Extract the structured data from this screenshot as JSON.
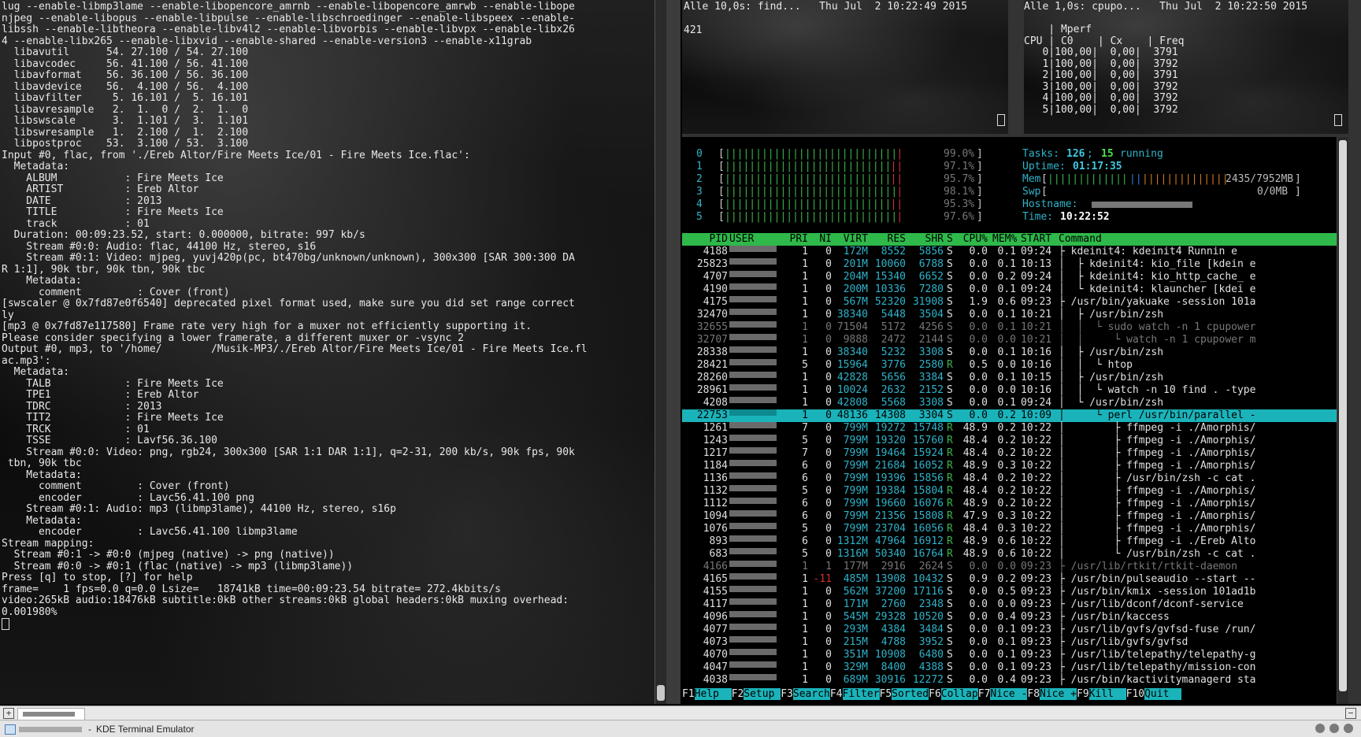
{
  "left_terminal": {
    "lines": [
      "lug --enable-libmp3lame --enable-libopencore_amrnb --enable-libopencore_amrwb --enable-libope",
      "njpeg --enable-libopus --enable-libpulse --enable-libschroedinger --enable-libspeex --enable-",
      "libssh --enable-libtheora --enable-libv4l2 --enable-libvorbis --enable-libvpx --enable-libx26",
      "4 --enable-libx265 --enable-libxvid --enable-shared --enable-version3 --enable-x11grab",
      "  libavutil      54. 27.100 / 54. 27.100",
      "  libavcodec     56. 41.100 / 56. 41.100",
      "  libavformat    56. 36.100 / 56. 36.100",
      "  libavdevice    56.  4.100 / 56.  4.100",
      "  libavfilter     5. 16.101 /  5. 16.101",
      "  libavresample   2.  1.  0 /  2.  1.  0",
      "  libswscale      3.  1.101 /  3.  1.101",
      "  libswresample   1.  2.100 /  1.  2.100",
      "  libpostproc    53.  3.100 / 53.  3.100",
      "Input #0, flac, from './Ereb Altor/Fire Meets Ice/01 - Fire Meets Ice.flac':",
      "  Metadata:",
      "    ALBUM           : Fire Meets Ice",
      "    ARTIST          : Ereb Altor",
      "    DATE            : 2013",
      "    TITLE           : Fire Meets Ice",
      "    track           : 01",
      "  Duration: 00:09:23.52, start: 0.000000, bitrate: 997 kb/s",
      "    Stream #0:0: Audio: flac, 44100 Hz, stereo, s16",
      "    Stream #0:1: Video: mjpeg, yuvj420p(pc, bt470bg/unknown/unknown), 300x300 [SAR 300:300 DA",
      "R 1:1], 90k tbr, 90k tbn, 90k tbc",
      "    Metadata:",
      "      comment         : Cover (front)",
      "[swscaler @ 0x7fd87e0f6540] deprecated pixel format used, make sure you did set range correct",
      "ly",
      "[mp3 @ 0x7fd87e117580] Frame rate very high for a muxer not efficiently supporting it.",
      "Please consider specifying a lower framerate, a different muxer or -vsync 2",
      "Output #0, mp3, to '/home/        /Musik-MP3/./Ereb Altor/Fire Meets Ice/01 - Fire Meets Ice.fl",
      "ac.mp3':",
      "  Metadata:",
      "    TALB            : Fire Meets Ice",
      "    TPE1            : Ereb Altor",
      "    TDRC            : 2013",
      "    TIT2            : Fire Meets Ice",
      "    TRCK            : 01",
      "    TSSE            : Lavf56.36.100",
      "    Stream #0:0: Video: png, rgb24, 300x300 [SAR 1:1 DAR 1:1], q=2-31, 200 kb/s, 90k fps, 90k",
      " tbn, 90k tbc",
      "    Metadata:",
      "      comment         : Cover (front)",
      "      encoder         : Lavc56.41.100 png",
      "    Stream #0:1: Audio: mp3 (libmp3lame), 44100 Hz, stereo, s16p",
      "    Metadata:",
      "      encoder         : Lavc56.41.100 libmp3lame",
      "Stream mapping:",
      "  Stream #0:1 -> #0:0 (mjpeg (native) -> png (native))",
      "  Stream #0:0 -> #0:1 (flac (native) -> mp3 (libmp3lame))",
      "Press [q] to stop, [?] for help",
      "frame=    1 fps=0.0 q=0.0 Lsize=   18741kB time=00:09:23.54 bitrate= 272.4kbits/s",
      "video:265kB audio:18476kB subtitle:0kB other streams:0kB global headers:0kB muxing overhead:",
      "0.001980%"
    ]
  },
  "watch_find": {
    "header": "Alle 10,0s: find...   Thu Jul  2 10:22:49 2015",
    "output": "421"
  },
  "watch_cpupower": {
    "header": "Alle 1,0s: cpupo...   Thu Jul  2 10:22:50 2015",
    "lines": [
      "    | Mperf",
      "CPU | C0    | Cx    | Freq",
      "   0|100,00|  0,00|  3791",
      "   1|100,00|  0,00|  3792",
      "   2|100,00|  0,00|  3791",
      "   3|100,00|  0,00|  3792",
      "   4|100,00|  0,00|  3792",
      "   5|100,00|  0,00|  3792"
    ]
  },
  "htop": {
    "cpus": [
      {
        "n": "0",
        "pct": "99.0%",
        "red": 1
      },
      {
        "n": "1",
        "pct": "97.1%",
        "red": 2
      },
      {
        "n": "2",
        "pct": "95.7%",
        "red": 2
      },
      {
        "n": "3",
        "pct": "98.1%",
        "red": 1
      },
      {
        "n": "4",
        "pct": "95.3%",
        "red": 2
      },
      {
        "n": "5",
        "pct": "97.6%",
        "red": 1
      }
    ],
    "tasks_label": "Tasks:",
    "tasks_count": "126",
    "running_count": "15",
    "running_label": "running",
    "uptime_label": "Uptime:",
    "uptime": "01:17:35",
    "mem_label": "Mem",
    "mem_value": "2435/7952MB",
    "swp_label": "Swp",
    "swp_value": "0/0MB",
    "hostname_label": "Hostname:",
    "time_label": "Time:",
    "time": "10:22:52",
    "header": {
      "pid": "PID",
      "user": "USER",
      "pri": "PRI",
      "ni": "NI",
      "virt": "VIRT",
      "res": "RES",
      "shr": "SHR",
      "s": "S",
      "cpu": "CPU%",
      "mem": "MEM%",
      "start": "START",
      "command": "Command"
    },
    "processes": [
      {
        "pid": "4188",
        "pri": "1",
        "ni": "0",
        "virt": "172M",
        "res": "8552",
        "shr": "5856",
        "s": "S",
        "cpu": "0.0",
        "mem": "0.1",
        "start": "09:24",
        "cmd": "├ kdeinit4: kdeinit4 Runnin e"
      },
      {
        "pid": "25823",
        "pri": "1",
        "ni": "0",
        "virt": "201M",
        "res": "10060",
        "shr": "6788",
        "s": "S",
        "cpu": "0.0",
        "mem": "0.1",
        "start": "10:13",
        "cmd": "│  ├ kdeinit4: kio_file [kdein e"
      },
      {
        "pid": "4707",
        "pri": "1",
        "ni": "0",
        "virt": "204M",
        "res": "15340",
        "shr": "6652",
        "s": "S",
        "cpu": "0.0",
        "mem": "0.2",
        "start": "09:24",
        "cmd": "│  ├ kdeinit4: kio_http_cache_ e"
      },
      {
        "pid": "4190",
        "pri": "1",
        "ni": "0",
        "virt": "200M",
        "res": "10336",
        "shr": "7280",
        "s": "S",
        "cpu": "0.0",
        "mem": "0.1",
        "start": "09:24",
        "cmd": "│  └ kdeinit4: klauncher [kdei e"
      },
      {
        "pid": "4175",
        "pri": "1",
        "ni": "0",
        "virt": "567M",
        "res": "52320",
        "shr": "31908",
        "s": "S",
        "cpu": "1.9",
        "mem": "0.6",
        "start": "09:23",
        "cmd": "├ /usr/bin/yakuake -session 101a"
      },
      {
        "pid": "32470",
        "pri": "1",
        "ni": "0",
        "virt": "38340",
        "res": "5448",
        "shr": "3504",
        "s": "S",
        "cpu": "0.0",
        "mem": "0.1",
        "start": "10:21",
        "cmd": "│  ├ /usr/bin/zsh"
      },
      {
        "pid": "32655",
        "pri": "1",
        "ni": "0",
        "virt": "71504",
        "res": "5172",
        "shr": "4256",
        "s": "S",
        "cpu": "0.0",
        "mem": "0.1",
        "start": "10:21",
        "cmd": "│  │  └ sudo watch -n 1 cpupower",
        "dim": true
      },
      {
        "pid": "32707",
        "pri": "1",
        "ni": "0",
        "virt": "9888",
        "res": "2472",
        "shr": "2144",
        "s": "S",
        "cpu": "0.0",
        "mem": "0.0",
        "start": "10:21",
        "cmd": "│  │     └ watch -n 1 cpupower m",
        "dim": true
      },
      {
        "pid": "28338",
        "pri": "1",
        "ni": "0",
        "virt": "38340",
        "res": "5232",
        "shr": "3308",
        "s": "S",
        "cpu": "0.0",
        "mem": "0.1",
        "start": "10:16",
        "cmd": "│  ├ /usr/bin/zsh"
      },
      {
        "pid": "28421",
        "pri": "5",
        "ni": "0",
        "virt": "15964",
        "res": "3776",
        "shr": "2580",
        "s": "R",
        "cpu": "0.5",
        "mem": "0.0",
        "start": "10:16",
        "cmd": "│  │  └ htop"
      },
      {
        "pid": "28260",
        "pri": "1",
        "ni": "0",
        "virt": "42828",
        "res": "5656",
        "shr": "3384",
        "s": "S",
        "cpu": "0.0",
        "mem": "0.1",
        "start": "10:15",
        "cmd": "│  ├ /usr/bin/zsh"
      },
      {
        "pid": "28961",
        "pri": "1",
        "ni": "0",
        "virt": "10024",
        "res": "2632",
        "shr": "2152",
        "s": "S",
        "cpu": "0.0",
        "mem": "0.0",
        "start": "10:16",
        "cmd": "│  │  └ watch -n 10 find . -type"
      },
      {
        "pid": "4208",
        "pri": "1",
        "ni": "0",
        "virt": "42808",
        "res": "5568",
        "shr": "3308",
        "s": "S",
        "cpu": "0.0",
        "mem": "0.1",
        "start": "09:24",
        "cmd": "│  └ /usr/bin/zsh"
      },
      {
        "pid": "22753",
        "pri": "1",
        "ni": "0",
        "virt": "48136",
        "res": "14308",
        "shr": "3304",
        "s": "S",
        "cpu": "0.0",
        "mem": "0.2",
        "start": "10:09",
        "cmd": "│     └ perl /usr/bin/parallel -",
        "sel": true
      },
      {
        "pid": "1261",
        "pri": "7",
        "ni": "0",
        "virt": "799M",
        "res": "19272",
        "shr": "15748",
        "s": "R",
        "cpu": "48.9",
        "mem": "0.2",
        "start": "10:22",
        "cmd": "│        ├ ffmpeg -i ./Amorphis/"
      },
      {
        "pid": "1243",
        "pri": "5",
        "ni": "0",
        "virt": "799M",
        "res": "19320",
        "shr": "15760",
        "s": "R",
        "cpu": "48.4",
        "mem": "0.2",
        "start": "10:22",
        "cmd": "│        ├ ffmpeg -i ./Amorphis/"
      },
      {
        "pid": "1217",
        "pri": "7",
        "ni": "0",
        "virt": "799M",
        "res": "19464",
        "shr": "15924",
        "s": "R",
        "cpu": "48.4",
        "mem": "0.2",
        "start": "10:22",
        "cmd": "│        ├ ffmpeg -i ./Amorphis/"
      },
      {
        "pid": "1184",
        "pri": "6",
        "ni": "0",
        "virt": "799M",
        "res": "21684",
        "shr": "16052",
        "s": "R",
        "cpu": "48.9",
        "mem": "0.3",
        "start": "10:22",
        "cmd": "│        ├ ffmpeg -i ./Amorphis/"
      },
      {
        "pid": "1136",
        "pri": "6",
        "ni": "0",
        "virt": "799M",
        "res": "19396",
        "shr": "15856",
        "s": "R",
        "cpu": "48.4",
        "mem": "0.2",
        "start": "10:22",
        "cmd": "│        ├ /usr/bin/zsh -c cat ."
      },
      {
        "pid": "1132",
        "pri": "5",
        "ni": "0",
        "virt": "799M",
        "res": "19384",
        "shr": "15804",
        "s": "R",
        "cpu": "48.4",
        "mem": "0.2",
        "start": "10:22",
        "cmd": "│        ├ ffmpeg -i ./Amorphis/"
      },
      {
        "pid": "1112",
        "pri": "6",
        "ni": "0",
        "virt": "799M",
        "res": "19660",
        "shr": "16076",
        "s": "R",
        "cpu": "48.9",
        "mem": "0.2",
        "start": "10:22",
        "cmd": "│        ├ ffmpeg -i ./Amorphis/"
      },
      {
        "pid": "1094",
        "pri": "6",
        "ni": "0",
        "virt": "799M",
        "res": "21356",
        "shr": "15808",
        "s": "R",
        "cpu": "47.9",
        "mem": "0.3",
        "start": "10:22",
        "cmd": "│        ├ ffmpeg -i ./Amorphis/"
      },
      {
        "pid": "1076",
        "pri": "5",
        "ni": "0",
        "virt": "799M",
        "res": "23704",
        "shr": "16056",
        "s": "R",
        "cpu": "48.4",
        "mem": "0.3",
        "start": "10:22",
        "cmd": "│        ├ ffmpeg -i ./Amorphis/"
      },
      {
        "pid": "893",
        "pri": "6",
        "ni": "0",
        "virt": "1312M",
        "res": "47964",
        "shr": "16912",
        "s": "R",
        "cpu": "48.9",
        "mem": "0.6",
        "start": "10:22",
        "cmd": "│        ├ ffmpeg -i ./Ereb Alto"
      },
      {
        "pid": "683",
        "pri": "5",
        "ni": "0",
        "virt": "1316M",
        "res": "50340",
        "shr": "16764",
        "s": "R",
        "cpu": "48.9",
        "mem": "0.6",
        "start": "10:22",
        "cmd": "│        └ /usr/bin/zsh -c cat ."
      },
      {
        "pid": "4166",
        "pri": "1",
        "ni": "1",
        "virt": "177M",
        "res": "2916",
        "shr": "2624",
        "s": "S",
        "cpu": "0.0",
        "mem": "0.0",
        "start": "09:23",
        "cmd": "├ /usr/lib/rtkit/rtkit-daemon",
        "dim": true
      },
      {
        "pid": "4165",
        "pri": "1",
        "ni": "-11",
        "virt": "485M",
        "res": "13908",
        "shr": "10432",
        "s": "S",
        "cpu": "0.9",
        "mem": "0.2",
        "start": "09:23",
        "cmd": "├ /usr/bin/pulseaudio --start --",
        "nired": true
      },
      {
        "pid": "4155",
        "pri": "1",
        "ni": "0",
        "virt": "562M",
        "res": "37200",
        "shr": "17116",
        "s": "S",
        "cpu": "0.0",
        "mem": "0.5",
        "start": "09:23",
        "cmd": "├ /usr/bin/kmix -session 101ad1b"
      },
      {
        "pid": "4117",
        "pri": "1",
        "ni": "0",
        "virt": "171M",
        "res": "2760",
        "shr": "2348",
        "s": "S",
        "cpu": "0.0",
        "mem": "0.0",
        "start": "09:23",
        "cmd": "├ /usr/lib/dconf/dconf-service"
      },
      {
        "pid": "4096",
        "pri": "1",
        "ni": "0",
        "virt": "545M",
        "res": "29328",
        "shr": "10520",
        "s": "S",
        "cpu": "0.0",
        "mem": "0.4",
        "start": "09:23",
        "cmd": "├ /usr/bin/kaccess"
      },
      {
        "pid": "4077",
        "pri": "1",
        "ni": "0",
        "virt": "293M",
        "res": "4384",
        "shr": "3484",
        "s": "S",
        "cpu": "0.0",
        "mem": "0.1",
        "start": "09:23",
        "cmd": "├ /usr/lib/gvfs/gvfsd-fuse /run/"
      },
      {
        "pid": "4073",
        "pri": "1",
        "ni": "0",
        "virt": "215M",
        "res": "4788",
        "shr": "3952",
        "s": "S",
        "cpu": "0.0",
        "mem": "0.1",
        "start": "09:23",
        "cmd": "├ /usr/lib/gvfs/gvfsd"
      },
      {
        "pid": "4070",
        "pri": "1",
        "ni": "0",
        "virt": "351M",
        "res": "10908",
        "shr": "6480",
        "s": "S",
        "cpu": "0.0",
        "mem": "0.1",
        "start": "09:23",
        "cmd": "├ /usr/lib/telepathy/telepathy-g"
      },
      {
        "pid": "4047",
        "pri": "1",
        "ni": "0",
        "virt": "329M",
        "res": "8400",
        "shr": "4388",
        "s": "S",
        "cpu": "0.0",
        "mem": "0.1",
        "start": "09:23",
        "cmd": "├ /usr/lib/telepathy/mission-con"
      },
      {
        "pid": "4038",
        "pri": "1",
        "ni": "0",
        "virt": "689M",
        "res": "30916",
        "shr": "12272",
        "s": "S",
        "cpu": "0.0",
        "mem": "0.4",
        "start": "09:23",
        "cmd": "├ /usr/bin/kactivitymanagerd sta"
      }
    ],
    "fkeys": [
      {
        "key": "F1",
        "label": "Help  "
      },
      {
        "key": "F2",
        "label": "Setup "
      },
      {
        "key": "F3",
        "label": "Search"
      },
      {
        "key": "F4",
        "label": "Filter"
      },
      {
        "key": "F5",
        "label": "Sorted"
      },
      {
        "key": "F6",
        "label": "Collap"
      },
      {
        "key": "F7",
        "label": "Nice -"
      },
      {
        "key": "F8",
        "label": "Nice +"
      },
      {
        "key": "F9",
        "label": "Kill  "
      },
      {
        "key": "F10",
        "label": "Quit  "
      }
    ]
  },
  "taskbar": {
    "title": "KDE Terminal Emulator"
  }
}
